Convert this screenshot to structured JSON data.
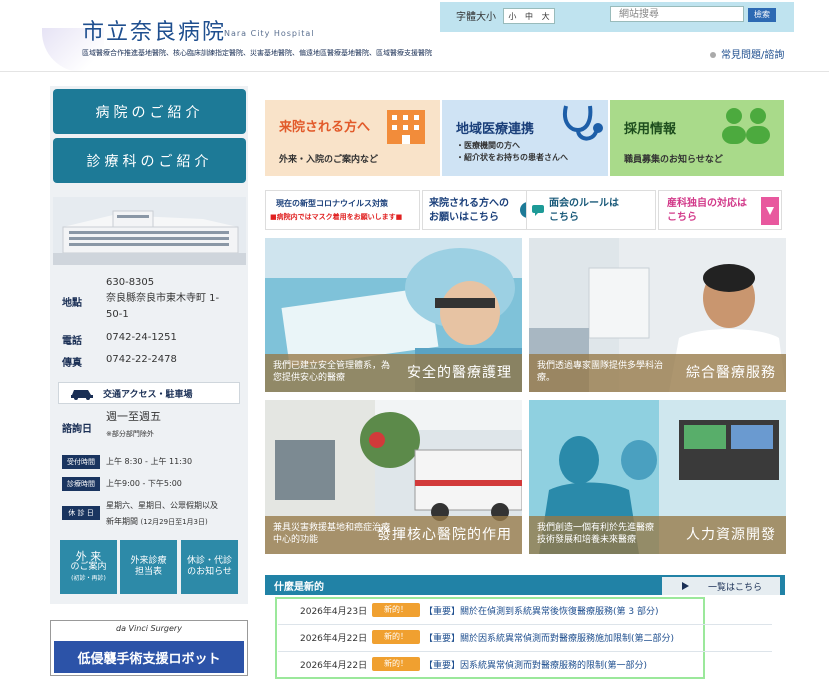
{
  "header": {
    "logo_title": "市立奈良病院",
    "logo_sub": "Nara City Hospital",
    "tagline": "區域醫療合作推進基地醫院、核心臨床訓練指定醫院、災害基地醫院、偏遠地區醫療基地醫院、區域醫療支援醫院",
    "font_size_label": "字體大小",
    "font_sizes": [
      "小",
      "中",
      "大"
    ],
    "search_placeholder": "網站搜尋",
    "search_button": "檢索",
    "faq_link": "常見問題/諮詢"
  },
  "left_nav": {
    "hospital_intro": "病院のご紹介",
    "departments_intro": "診療科のご紹介"
  },
  "contact": {
    "address_label": "地點",
    "postal": "630-8305",
    "address_line1": "奈良縣奈良市東木寺町 1-",
    "address_line2": "50-1",
    "phone_label": "電話",
    "phone": "0742-24-1251",
    "fax_label": "傳真",
    "fax": "0742-22-2478",
    "access_button": "交通アクセス・駐車場",
    "consult_label": "諮詢日",
    "consult_days": "週一至週五",
    "consult_note": "※部分部門除外",
    "reception_label": "受付時間",
    "reception_hours": "上午 8:30 - 上午 11:30",
    "clinic_label": "診療時間",
    "clinic_hours": "上午9:00 - 下午5:00",
    "holiday_label": "休 診 日",
    "holiday_line1": "星期六、星期日、公眾假期以及",
    "holiday_line2": "新年期間",
    "holiday_note": "(12月29日至1月3日)"
  },
  "square_buttons": [
    {
      "line1": "外 来",
      "line2": "のご案内",
      "line3": "(初診・再診)"
    },
    {
      "line1": "外来診療",
      "line2": "担当表",
      "line3": ""
    },
    {
      "line1": "休診・代診",
      "line2": "のお知らせ",
      "line3": ""
    }
  ],
  "davinci": {
    "brand": "da Vinci Surgery",
    "label": "低侵襲手術支援ロボット"
  },
  "banners": [
    {
      "title": "来院される方へ",
      "sub": "外来・入院のご案内など",
      "color": "#f9e3c9",
      "title_color": "#e25a2a"
    },
    {
      "title": "地域医療連携",
      "sub": "・医療機関の方へ\n・紹介状をお持ちの患者さんへ",
      "color": "#cfe3f4",
      "title_color": "#1a3f7a"
    },
    {
      "title": "採用情報",
      "sub": "職員募集のお知らせなど",
      "color": "#a9da8a",
      "title_color": "#1d4d1d"
    }
  ],
  "notices": [
    {
      "line1": "現在の新型コロナウイルス対策",
      "line2": "■病院内ではマスク着用をお願いします■"
    },
    {
      "line1": "来院される方への",
      "line2": "お願いはこちら"
    },
    {
      "line1": "面会のルールは",
      "line2": "こちら"
    },
    {
      "line1": "産科独自の対応は",
      "line2": "こちら"
    }
  ],
  "tiles": [
    {
      "text": "我們已建立安全管理體系，為您提供安心的醫療",
      "title": "安全的醫療護理"
    },
    {
      "text": "我們透過專家團隊提供多學科治療。",
      "title": "綜合醫療服務"
    },
    {
      "text": "兼具災害救援基地和癌症治療中心的功能",
      "title": "發揮核心醫院的作用"
    },
    {
      "text": "我們創造一個有利於先進醫療技術發展和培養未來醫療",
      "title": "人力資源開發"
    }
  ],
  "news": {
    "header": "什麼是新的",
    "more": "一覧はこちら",
    "badge": "新的！",
    "items": [
      {
        "date": "2026年4月23日",
        "title": "【重要】關於在偵測到系統異常後恢復醫療服務(第 3 部分)"
      },
      {
        "date": "2026年4月22日",
        "title": "【重要】關於因系統異常偵測而對醫療服務施加限制(第二部分)"
      },
      {
        "date": "2026年4月22日",
        "title": "【重要】因系統異常偵測而對醫療服務的限制(第一部分)"
      }
    ]
  }
}
